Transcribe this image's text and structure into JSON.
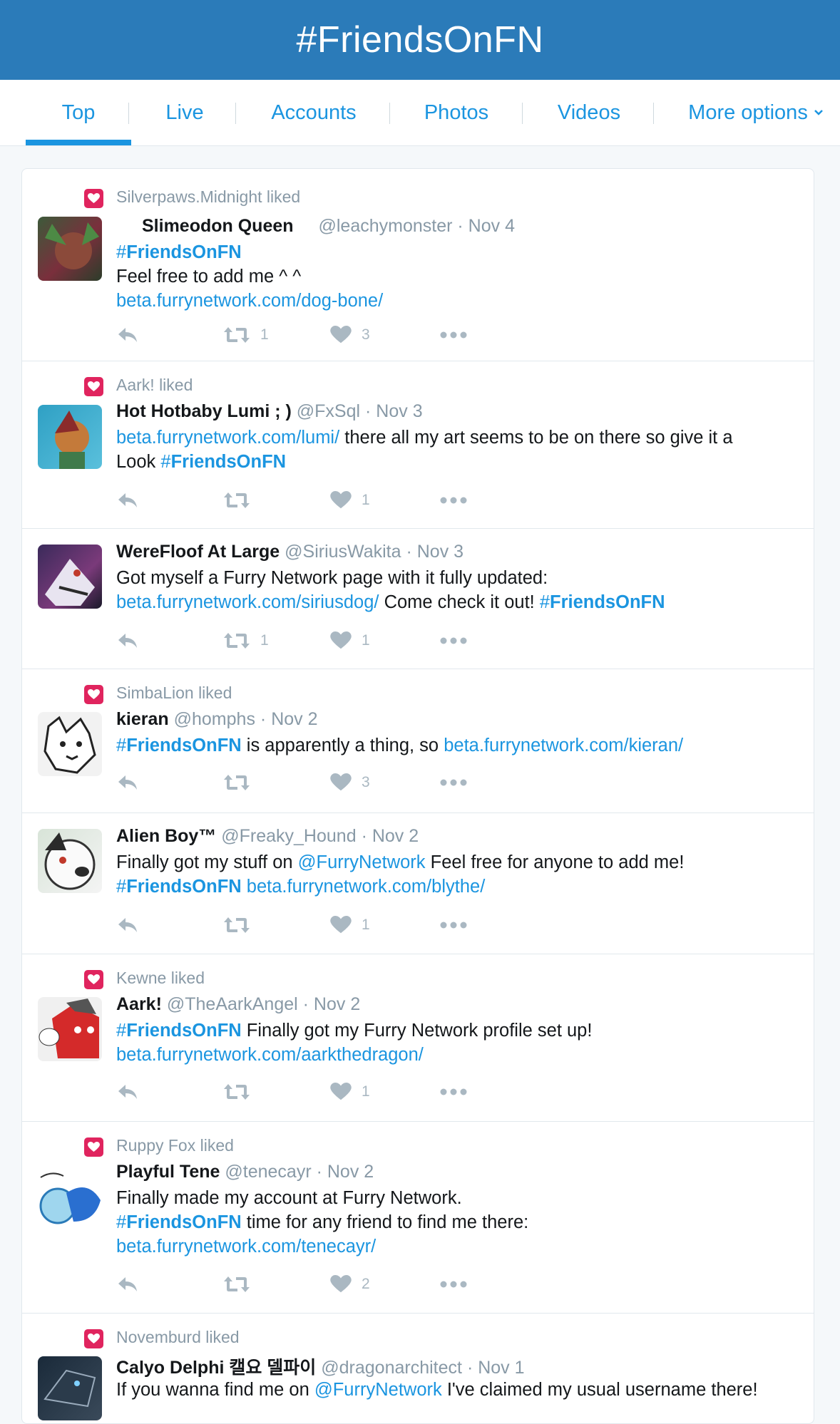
{
  "header": {
    "title": "#FriendsOnFN"
  },
  "tabs": [
    {
      "label": "Top"
    },
    {
      "label": "Live"
    },
    {
      "label": "Accounts"
    },
    {
      "label": "Photos"
    },
    {
      "label": "Videos"
    },
    {
      "label": "More options"
    }
  ],
  "colors": {
    "header": "#2b7bb9",
    "accent": "#1b95e0",
    "like": "#e0245e",
    "muted": "#8899a6"
  },
  "tweets": [
    {
      "liked_by": "Silverpaws.Midnight liked",
      "name": "Slimeodon Queen",
      "handle": "@leachymonster",
      "date": "Nov 4",
      "line1_tag": "FriendsOnFN",
      "line2": "Feel free to add me ^ ^",
      "line3_link": "beta.furrynetwork.com/dog-bone/",
      "retweets": "1",
      "likes": "3"
    },
    {
      "liked_by": "Aark! liked",
      "name": "Hot Hotbaby Lumi ; )",
      "handle": "@FxSql",
      "date": "Nov 3",
      "link": "beta.furrynetwork.com/lumi/",
      "text_a": " there all my art seems to be on there so give it a",
      "text_b": "Look ",
      "tag": "FriendsOnFN",
      "retweets": "",
      "likes": "1"
    },
    {
      "name": "WereFloof At Large",
      "handle": "@SiriusWakita",
      "date": "Nov 3",
      "line1": "Got myself a Furry Network page with it fully updated:",
      "link": "beta.furrynetwork.com/siriusdog/",
      "text": " Come check it out! ",
      "tag": "FriendsOnFN",
      "retweets": "1",
      "likes": "1"
    },
    {
      "liked_by": "SimbaLion liked",
      "name": "kieran",
      "handle": "@homphs",
      "date": "Nov 2",
      "tag": "FriendsOnFN",
      "text": " is apparently a thing, so ",
      "link": "beta.furrynetwork.com/kieran/",
      "retweets": "",
      "likes": "3"
    },
    {
      "name": "Alien Boy™",
      "handle": "@Freaky_Hound",
      "date": "Nov 2",
      "text_a": "Finally got my stuff on ",
      "mention": "@FurryNetwork",
      "text_b": " Feel free for anyone to add me!",
      "tag": "FriendsOnFN",
      "link": "beta.furrynetwork.com/blythe/",
      "retweets": "",
      "likes": "1"
    },
    {
      "liked_by": "Kewne liked",
      "name": "Aark!",
      "handle": "@TheAarkAngel",
      "date": "Nov 2",
      "tag": "FriendsOnFN",
      "text": " Finally got my Furry Network profile set up!",
      "link": "beta.furrynetwork.com/aarkthedragon/",
      "retweets": "",
      "likes": "1"
    },
    {
      "liked_by": "Ruppy Fox liked",
      "name": "Playful Tene",
      "handle": "@tenecayr",
      "date": "Nov 2",
      "line1": "Finally made my account at Furry Network.",
      "tag": "FriendsOnFN",
      "text": " time for any friend to find me there:",
      "link": "beta.furrynetwork.com/tenecayr/",
      "retweets": "",
      "likes": "2"
    },
    {
      "liked_by": "Novemburd liked",
      "name": "Calyo Delphi 캘요 델파이",
      "handle": "@dragonarchitect",
      "date": "Nov 1",
      "text_a": "If you wanna find me on ",
      "mention": "@FurryNetwork",
      "text_b": " I've claimed my usual username there!"
    }
  ],
  "sep": "·",
  "hash": "#"
}
